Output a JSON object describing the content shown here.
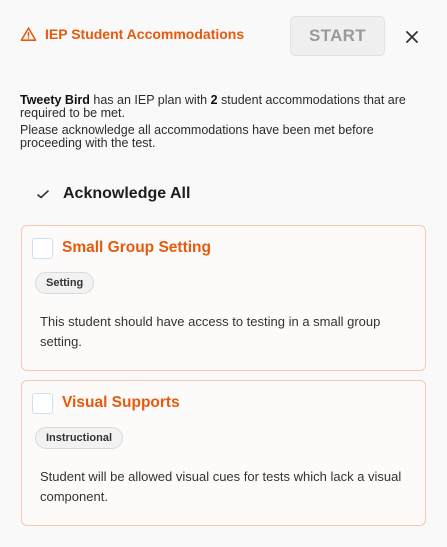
{
  "header": {
    "title": "IEP Student Accommodations",
    "start_label": "START",
    "close_icon": "close-icon",
    "warning_icon": "warning-triangle-icon",
    "accent_color": "#e8590c"
  },
  "intro": {
    "student_name": "Tweety Bird",
    "text_a": " has an IEP plan with ",
    "count": "2",
    "text_b": " student accommodations that are required to be met.",
    "line2": "Please acknowledge all accommodations have been met before proceeding with the test."
  },
  "acknowledge_all": {
    "label": "Acknowledge All",
    "icon": "check-icon"
  },
  "accommodations": [
    {
      "title": "Small Group Setting",
      "category": "Setting",
      "description": "This student should have access to testing in a small group setting.",
      "checked": false
    },
    {
      "title": "Visual Supports",
      "category": "Instructional",
      "description": "Student will be allowed visual cues for tests which lack a visual component.",
      "checked": false
    }
  ]
}
